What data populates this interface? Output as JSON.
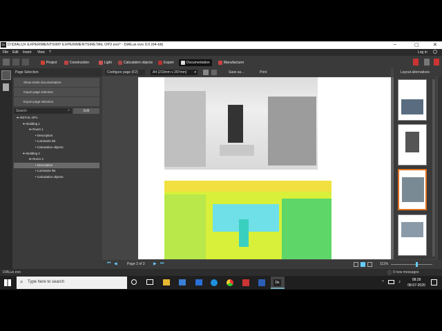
{
  "window": {
    "title": "D:\\DIALUX EXPERIMENTS\\MY EXPERIMENTS\\RETAIL OP2.evo* - DIALux evo 9.0  (64-bit)",
    "login": "Log in"
  },
  "menu": [
    "File",
    "Edit",
    "Insert",
    "View",
    "?"
  ],
  "toolbar": {
    "tabs": [
      "Project",
      "Construction",
      "Light",
      "Calculation objects",
      "Export",
      "Documentation",
      "Manufacturer"
    ],
    "active": "Documentation"
  },
  "page_selection": {
    "title": "Page Selection",
    "actions": [
      "Show entire documentation",
      "Import page selection",
      "Export page selection"
    ],
    "search_placeholder": "Search",
    "edit_label": "Edit"
  },
  "tree": [
    {
      "label": "RETAIL OP1",
      "level": 0
    },
    {
      "label": "Building 1",
      "level": 1
    },
    {
      "label": "Room 1",
      "level": 2
    },
    {
      "label": "Description",
      "level": 3
    },
    {
      "label": "Luminaire list",
      "level": 3
    },
    {
      "label": "Calculation objects",
      "level": 3
    },
    {
      "label": "Building 2",
      "level": 1
    },
    {
      "label": "Room 2",
      "level": 2
    },
    {
      "label": "Description",
      "level": 3,
      "selected": true
    },
    {
      "label": "Luminaire list",
      "level": 3
    },
    {
      "label": "Calculation objects",
      "level": 3
    }
  ],
  "doc_toolbar": {
    "configure": "Configure page (F2)",
    "paper": "A4 (210mm x 297mm)",
    "save_as": "Save as...",
    "print": "Print"
  },
  "layout_alternatives": "Layout alternatives",
  "pager": {
    "text": "Page 2 of 3",
    "zoom": "111%"
  },
  "status": {
    "left": "DIALux evo",
    "messages": "0 new messages"
  },
  "taskbar": {
    "search_placeholder": "Type here to search",
    "time": "08:28",
    "date": "08-07-2020"
  }
}
